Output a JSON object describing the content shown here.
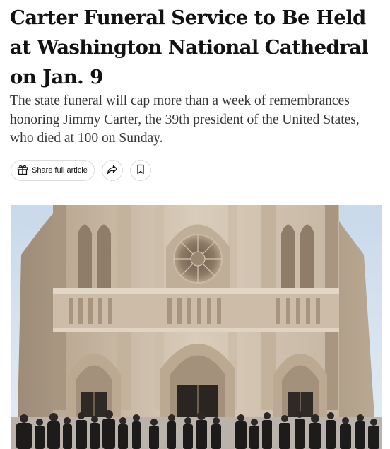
{
  "article": {
    "headline": "Carter Funeral Service to Be Held at Washington National Cathedral on Jan. 9",
    "summary": "The state funeral will cap more than a week of remembrances honoring Jimmy Carter, the 39th president of the United States, who died at 100 on Sunday."
  },
  "actions": {
    "share_label": "Share full article",
    "share_icon": "gift-icon",
    "forward_icon": "share-arrow-icon",
    "save_icon": "bookmark-icon"
  },
  "photo": {
    "subject": "Washington National Cathedral facade with mourners"
  }
}
